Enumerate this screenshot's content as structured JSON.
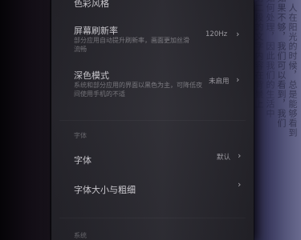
{
  "settings": {
    "color_style": {
      "title": "色彩风格"
    },
    "refresh_rate": {
      "title": "屏幕刷新率",
      "desc": "部分应用自动提升刷新率，画面更加丝滑流畅",
      "value": "120Hz"
    },
    "dark_mode": {
      "title": "深色模式",
      "desc": "系统和部分应用的界面以黑色为主，可降低夜间使用手机的不适",
      "value": "未启用"
    },
    "font_section": "字体",
    "font": {
      "title": "字体",
      "value": "默认"
    },
    "font_size": {
      "title": "字体大小与粗细"
    },
    "system_section": "系统"
  },
  "background_text": [
    "一人在阳光的时候，总是能够看到",
    "如果不够，我们可以看到，我们",
    "如何处理，因此我们的生活中",
    "第二段的文字内容在背景上"
  ]
}
